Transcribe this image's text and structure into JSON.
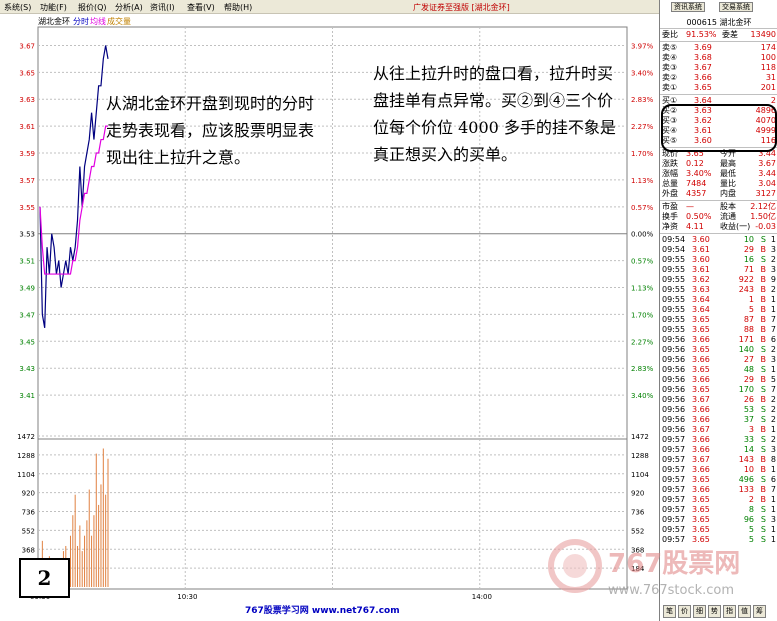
{
  "menu": {
    "items": [
      "系统(S)",
      "功能(F)",
      "报价(Q)",
      "分析(A)",
      "资讯(I)",
      "查看(V)",
      "帮助(H)"
    ],
    "app_title": "广发证券至强版 [湖北金环]"
  },
  "chart_header": {
    "stock": "湖北金环",
    "tab_fenshi": "分时",
    "tab_junjia": "均线",
    "tab_volume": "成交量"
  },
  "chart_data": {
    "type": "line",
    "price_ticks_left": [
      "3.67",
      "3.65",
      "3.63",
      "3.61",
      "3.59",
      "3.57",
      "3.55",
      "3.53",
      "3.51",
      "3.49",
      "3.47",
      "3.45",
      "3.43",
      "3.41"
    ],
    "pct_ticks_right": [
      "3.97%",
      "3.40%",
      "2.83%",
      "2.27%",
      "1.70%",
      "1.13%",
      "0.57%",
      "0.00%",
      "0.57%",
      "1.13%",
      "1.70%",
      "2.27%",
      "2.83%",
      "3.40%"
    ],
    "volume_ticks": [
      "1472",
      "1288",
      "1104",
      "920",
      "736",
      "552",
      "368",
      "184"
    ],
    "x_ticks": [
      "09:30",
      "10:30",
      "14:00"
    ],
    "base_price": 3.53,
    "ylim": [
      3.39,
      3.68
    ],
    "vol_max": 1472,
    "price_series": {
      "name": "分时",
      "color": "#000080",
      "values": [
        3.55,
        3.47,
        3.46,
        3.52,
        3.5,
        3.53,
        3.52,
        3.5,
        3.51,
        3.49,
        3.5,
        3.51,
        3.5,
        3.52,
        3.51,
        3.52,
        3.54,
        3.58,
        3.55,
        3.58,
        3.59,
        3.6,
        3.62,
        3.6,
        3.62,
        3.64,
        3.64,
        3.66,
        3.67,
        3.66
      ]
    },
    "avg_series": {
      "name": "均线",
      "color": "#e000e0",
      "values": [
        3.55,
        3.52,
        3.5,
        3.5,
        3.5,
        3.5,
        3.5,
        3.5,
        3.5,
        3.5,
        3.5,
        3.5,
        3.5,
        3.5,
        3.51,
        3.51,
        3.52,
        3.54,
        3.55,
        3.56,
        3.56,
        3.57,
        3.58,
        3.58,
        3.59,
        3.59,
        3.6,
        3.6,
        3.61,
        3.61
      ]
    },
    "volumes": [
      200,
      450,
      120,
      80,
      300,
      100,
      120,
      80,
      150,
      200,
      350,
      400,
      200,
      500,
      700,
      900,
      400,
      600,
      350,
      500,
      650,
      950,
      500,
      700,
      1300,
      800,
      1000,
      1350,
      900,
      1250
    ]
  },
  "right_panel": {
    "tabs": [
      "资讯系统",
      "交易系统"
    ],
    "stock_code": "000615",
    "stock_name": "湖北金环",
    "weibi_label": "委比",
    "weibi_value": "91.53%",
    "weicha_label": "委差",
    "weicha_value": "13490",
    "sell": [
      {
        "label": "卖⑤",
        "price": "3.69",
        "vol": "174"
      },
      {
        "label": "卖④",
        "price": "3.68",
        "vol": "100"
      },
      {
        "label": "卖③",
        "price": "3.67",
        "vol": "118"
      },
      {
        "label": "卖②",
        "price": "3.66",
        "vol": "31"
      },
      {
        "label": "卖①",
        "price": "3.65",
        "vol": "201"
      }
    ],
    "buy": [
      {
        "label": "买①",
        "price": "3.64",
        "vol": "2"
      },
      {
        "label": "买②",
        "price": "3.63",
        "vol": "4896"
      },
      {
        "label": "买③",
        "price": "3.62",
        "vol": "4070"
      },
      {
        "label": "买④",
        "price": "3.61",
        "vol": "4999"
      },
      {
        "label": "买⑤",
        "price": "3.60",
        "vol": "116"
      }
    ],
    "stats": [
      {
        "l1": "现价",
        "v1": "3.65",
        "l2": "今开",
        "v2": "3.44"
      },
      {
        "l1": "涨跌",
        "v1": "0.12",
        "l2": "最高",
        "v2": "3.67"
      },
      {
        "l1": "涨幅",
        "v1": "3.40%",
        "l2": "最低",
        "v2": "3.44"
      },
      {
        "l1": "总量",
        "v1": "7484",
        "l2": "量比",
        "v2": "3.04"
      },
      {
        "l1": "外盘",
        "v1": "4357",
        "l2": "内盘",
        "v2": "3127"
      }
    ],
    "stats2": [
      {
        "l1": "市盈",
        "v1": "—",
        "l2": "股本",
        "v2": "2.12亿"
      },
      {
        "l1": "换手",
        "v1": "0.50%",
        "l2": "流通",
        "v2": "1.50亿"
      },
      {
        "l1": "净资",
        "v1": "4.11",
        "l2": "收益(一)",
        "v2": "-0.03"
      }
    ],
    "trades": [
      [
        "09:54",
        "3.60",
        "10",
        "S",
        "1"
      ],
      [
        "09:54",
        "3.61",
        "29",
        "B",
        "3"
      ],
      [
        "09:55",
        "3.60",
        "16",
        "S",
        "2"
      ],
      [
        "09:55",
        "3.61",
        "71",
        "B",
        "3"
      ],
      [
        "09:55",
        "3.62",
        "922",
        "B",
        "9"
      ],
      [
        "09:55",
        "3.63",
        "243",
        "B",
        "2"
      ],
      [
        "09:55",
        "3.64",
        "1",
        "B",
        "1"
      ],
      [
        "09:55",
        "3.64",
        "5",
        "B",
        "1"
      ],
      [
        "09:55",
        "3.65",
        "87",
        "B",
        "7"
      ],
      [
        "09:55",
        "3.65",
        "88",
        "B",
        "7"
      ],
      [
        "09:56",
        "3.66",
        "171",
        "B",
        "6"
      ],
      [
        "09:56",
        "3.65",
        "140",
        "S",
        "2"
      ],
      [
        "09:56",
        "3.66",
        "27",
        "B",
        "3"
      ],
      [
        "09:56",
        "3.65",
        "48",
        "S",
        "1"
      ],
      [
        "09:56",
        "3.66",
        "29",
        "B",
        "5"
      ],
      [
        "09:56",
        "3.65",
        "170",
        "S",
        "7"
      ],
      [
        "09:56",
        "3.67",
        "26",
        "B",
        "2"
      ],
      [
        "09:56",
        "3.66",
        "53",
        "S",
        "2"
      ],
      [
        "09:56",
        "3.66",
        "37",
        "S",
        "2"
      ],
      [
        "09:56",
        "3.67",
        "3",
        "B",
        "1"
      ],
      [
        "09:57",
        "3.66",
        "33",
        "S",
        "2"
      ],
      [
        "09:57",
        "3.66",
        "14",
        "S",
        "3"
      ],
      [
        "09:57",
        "3.67",
        "143",
        "B",
        "8"
      ],
      [
        "09:57",
        "3.66",
        "10",
        "B",
        "1"
      ],
      [
        "09:57",
        "3.65",
        "496",
        "S",
        "6"
      ],
      [
        "09:57",
        "3.66",
        "133",
        "B",
        "7"
      ],
      [
        "09:57",
        "3.65",
        "2",
        "B",
        "1"
      ],
      [
        "09:57",
        "3.65",
        "8",
        "S",
        "1"
      ],
      [
        "09:57",
        "3.65",
        "96",
        "S",
        "3"
      ],
      [
        "09:57",
        "3.65",
        "5",
        "S",
        "1"
      ],
      [
        "09:57",
        "3.65",
        "5",
        "S",
        "1"
      ]
    ],
    "bottom_tabs": [
      "笔",
      "价",
      "细",
      "势",
      "指",
      "值",
      "筹"
    ]
  },
  "annotations": {
    "left": "从湖北金环开盘到现时的分时走势表现看，应该股票明显表现出往上拉升之意。",
    "right": "从往上拉升时的盘口看，拉升时买盘挂单有点异常。买②到④三个价位每个价位 4000 多手的挂不象是真正想买入的买单。",
    "figure_label": "2"
  },
  "footer": {
    "site": "767股票学习网 www.net767.com"
  },
  "watermark": {
    "brand": "767股票网",
    "url": "www.767stock.com"
  }
}
